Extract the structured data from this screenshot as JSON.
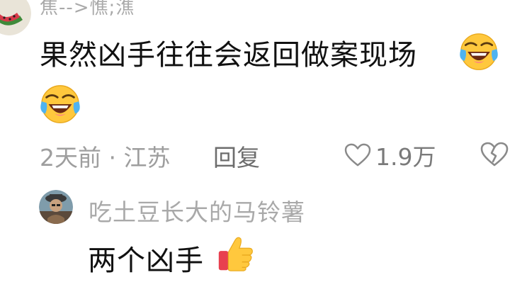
{
  "comment": {
    "username": "焦-->憔;潐",
    "text": "果然凶手往往会返回做案现场",
    "emojis": [
      "laughing-crying-emoji",
      "laughing-crying-emoji"
    ],
    "time_location": "2天前 · 江苏",
    "reply_label": "回复",
    "like_count": "1.9万"
  },
  "reply": {
    "username": "吃土豆长大的马铃薯",
    "text": "两个凶手",
    "emoji": "thumbs-up-emoji"
  },
  "colors": {
    "username": "#a9a9a9",
    "text": "#111111",
    "meta": "#9e9e9e",
    "background": "#ffffff"
  }
}
